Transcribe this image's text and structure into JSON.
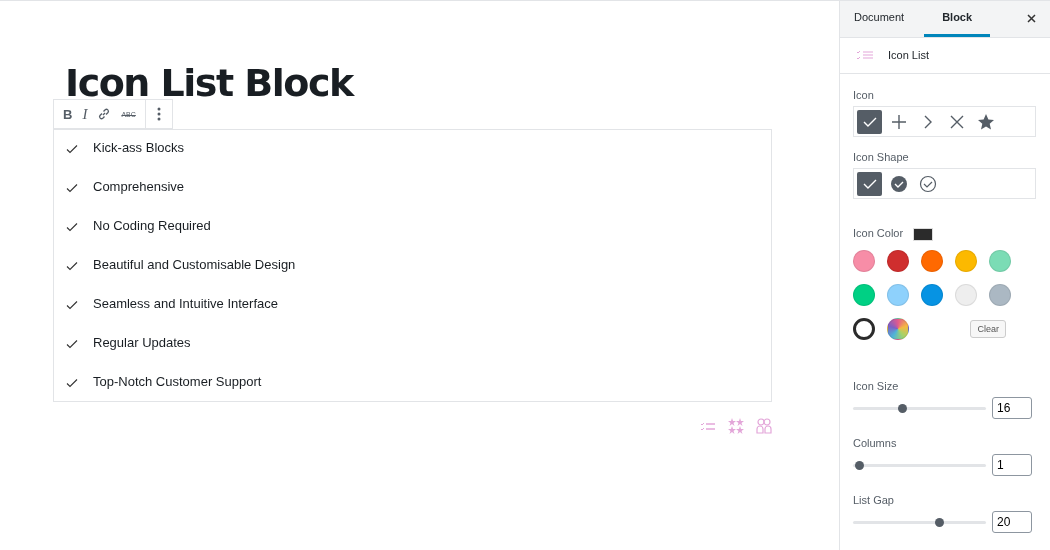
{
  "editor": {
    "title": "Icon List Block",
    "format_toolbar": [
      {
        "kind": "bold",
        "label": "B"
      },
      {
        "kind": "italic",
        "label": "I"
      },
      {
        "kind": "link"
      },
      {
        "kind": "strike",
        "label": "ABC"
      },
      {
        "kind": "more"
      }
    ],
    "list_items": [
      "Kick-ass Blocks",
      "Comprehensive",
      "No Coding Required",
      "Beautiful and Customisable Design",
      "Seamless and Intuitive Interface",
      "Regular Updates",
      "Top-Notch Customer Support"
    ],
    "block_actions": [
      {
        "kind": "list"
      },
      {
        "kind": "stars"
      },
      {
        "kind": "people"
      }
    ]
  },
  "sidebar": {
    "tabs": [
      {
        "label": "Document",
        "selected": false
      },
      {
        "label": "Block",
        "selected": true
      }
    ],
    "block_name": "Icon List",
    "icon": {
      "label": "Icon",
      "options": [
        {
          "kind": "check",
          "selected": true
        },
        {
          "kind": "plus",
          "selected": false
        },
        {
          "kind": "chevron",
          "selected": false
        },
        {
          "kind": "cross",
          "selected": false
        },
        {
          "kind": "star",
          "selected": false
        }
      ]
    },
    "icon_shape": {
      "label": "Icon Shape",
      "options": [
        {
          "kind": "plain",
          "selected": true
        },
        {
          "kind": "filled_circle",
          "selected": false
        },
        {
          "kind": "outline_circle",
          "selected": false
        }
      ]
    },
    "icon_color": {
      "label": "Icon Color",
      "color": "#2b2b2b",
      "swatches": [
        {
          "color": "#f78da7",
          "selected": false
        },
        {
          "color": "#cf2e2e",
          "selected": false
        },
        {
          "color": "#ff6900",
          "selected": false
        },
        {
          "color": "#fcb900",
          "selected": false
        },
        {
          "color": "#7bdcb5",
          "selected": false
        },
        {
          "color": "#00d084",
          "selected": false
        },
        {
          "color": "#8ed1fc",
          "selected": false
        },
        {
          "color": "#0693e3",
          "selected": false
        },
        {
          "color": "#eeeeee",
          "selected": false
        },
        {
          "color": "#abb8c3",
          "selected": false
        },
        {
          "color": "#2b2b2b",
          "selected": true
        }
      ],
      "clear_label": "Clear"
    },
    "sliders": [
      {
        "label": "Icon Size",
        "level": 0.37,
        "value": "16"
      },
      {
        "label": "Columns",
        "level": 0.045,
        "value": "1"
      },
      {
        "label": "List Gap",
        "level": 0.65,
        "value": "20"
      }
    ]
  }
}
